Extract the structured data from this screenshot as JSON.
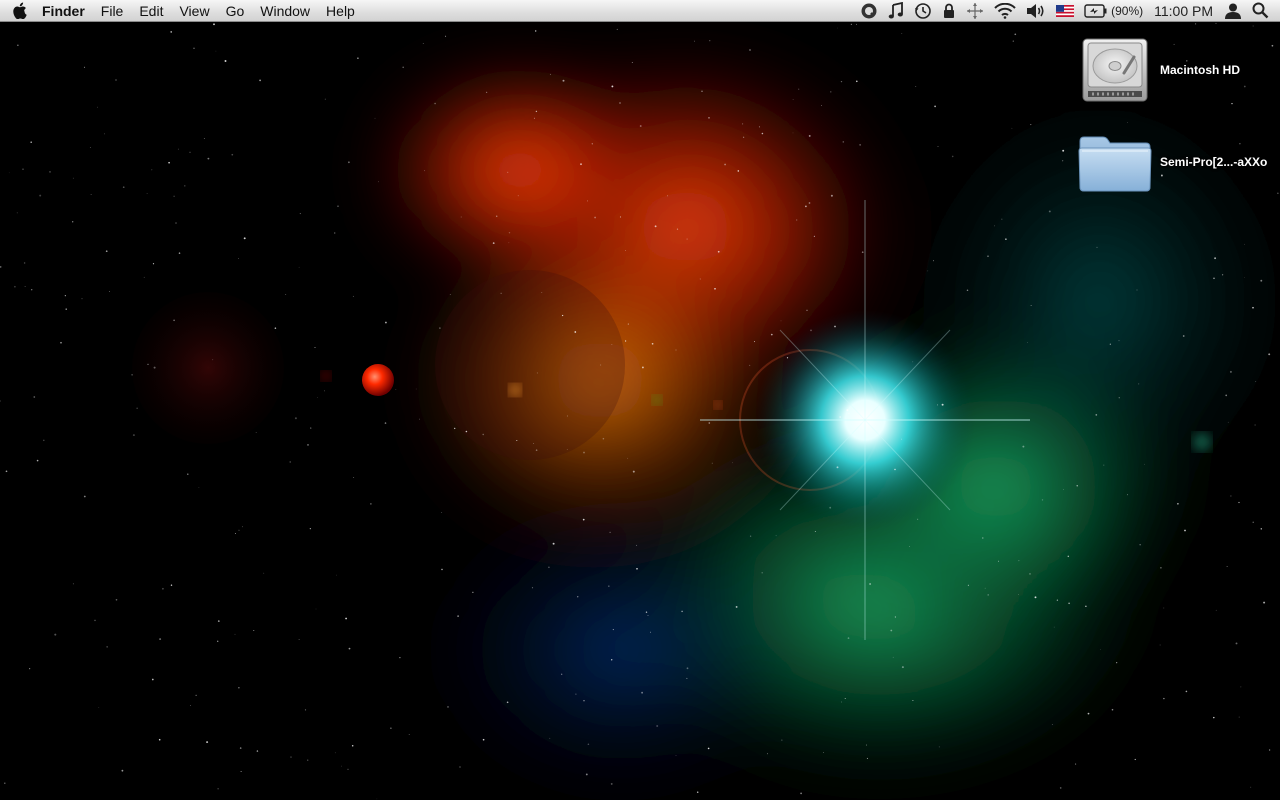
{
  "menubar": {
    "apple_icon": "apple-icon",
    "app_name": "Finder",
    "menus": [
      "File",
      "Edit",
      "View",
      "Go",
      "Window",
      "Help"
    ],
    "status_icons": [
      "quicktime-icon",
      "itunes-icon",
      "time-machine-icon",
      "lock-icon",
      "spaces-icon",
      "wifi-icon",
      "volume-icon",
      "us-flag-icon"
    ],
    "battery": {
      "percent_label": "(90%)",
      "icon": "battery-charging-icon"
    },
    "clock": "11:00 PM",
    "user_icon": "user-icon",
    "spotlight_icon": "spotlight-icon"
  },
  "desktop": {
    "icons": [
      {
        "label": "Macintosh HD",
        "icon": "hard-drive-icon"
      },
      {
        "label": "Semi-Pro[2...-aXXo",
        "icon": "folder-icon"
      }
    ]
  },
  "colors": {
    "menubar_bg": "#dedede",
    "folder_blue": "#8fb8dc",
    "wallpaper_red": "#d23a10",
    "wallpaper_green": "#1fa060",
    "wallpaper_cyan": "#4fe4f0"
  }
}
